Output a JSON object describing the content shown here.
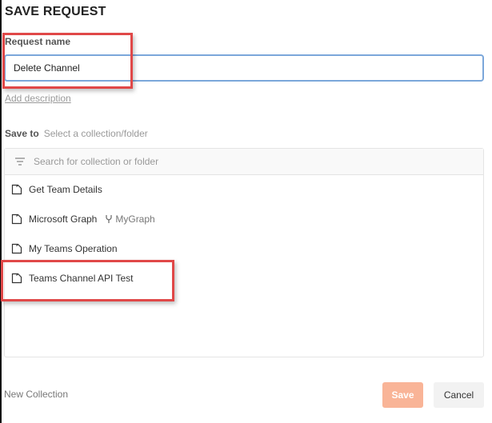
{
  "dialog": {
    "title": "SAVE REQUEST"
  },
  "request_name": {
    "label": "Request name",
    "value": "Delete Channel"
  },
  "add_description": "Add description",
  "save_to": {
    "label": "Save to",
    "placeholder": "Select a collection/folder"
  },
  "search": {
    "placeholder": "Search for collection or folder"
  },
  "collections": [
    {
      "name": "Get Team Details"
    },
    {
      "name": "Microsoft Graph",
      "fork": "MyGraph"
    },
    {
      "name": "My Teams Operation"
    },
    {
      "name": "Teams Channel API Test"
    }
  ],
  "footer": {
    "new_collection": "New Collection",
    "save": "Save",
    "cancel": "Cancel"
  },
  "colors": {
    "accent": "#f9b497",
    "focus": "#7ba7da",
    "highlight": "#e04848"
  }
}
